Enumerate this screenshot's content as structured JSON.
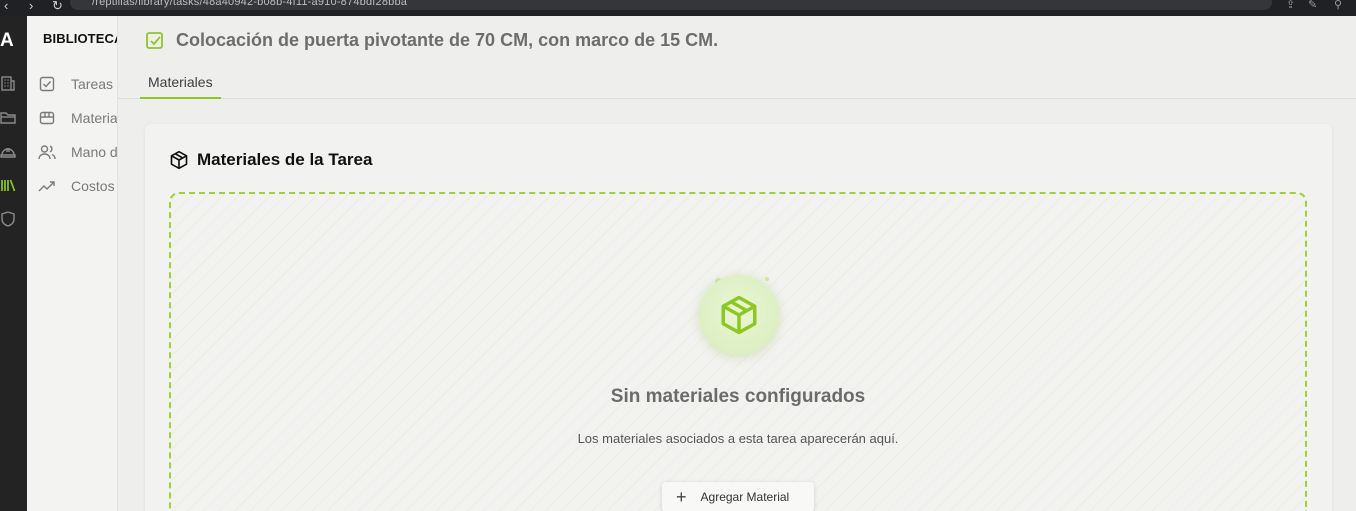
{
  "browser": {
    "url": "/reptilias/library/tasks/48a40942-b08b-4f11-a910-874bdf28bba"
  },
  "rail": {
    "logo": "A",
    "icons": [
      "building-icon",
      "folder-icon",
      "hardhat-icon",
      "library-icon",
      "shield-icon"
    ],
    "active_color": "#8cc81e"
  },
  "sidebar": {
    "title": "BIBLIOTECA",
    "items": [
      {
        "label": "Tareas",
        "icon": "check-square-icon"
      },
      {
        "label": "Materiales",
        "icon": "package-icon"
      },
      {
        "label": "Mano de obra",
        "icon": "users-icon"
      },
      {
        "label": "Costos",
        "icon": "trending-up-icon"
      }
    ]
  },
  "header": {
    "title": "Colocación de puerta pivotante de 70 CM, con marco de 15 CM.",
    "tabs": [
      {
        "label": "Materiales"
      }
    ]
  },
  "card": {
    "title": "Materiales de la Tarea",
    "empty_title": "Sin materiales configurados",
    "empty_description": "Los materiales asociados a esta tarea aparecerán aquí.",
    "add_button_label": "Agregar Material"
  },
  "colors": {
    "accent": "#8cc81e",
    "text_muted": "#6d6d6d",
    "background": "#eeeeec"
  }
}
